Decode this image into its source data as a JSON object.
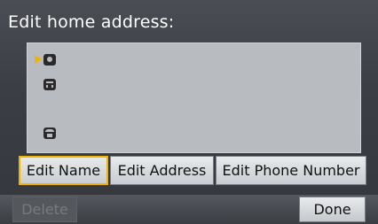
{
  "screen": {
    "title": "Edit home address:"
  },
  "address_list": {
    "entries": [
      {
        "icon": "person-icon",
        "selected": true
      },
      {
        "icon": "home-icon",
        "selected": false
      },
      {
        "icon": "phone-icon",
        "selected": false
      }
    ]
  },
  "tabs": [
    {
      "label": "Edit Name",
      "selected": true
    },
    {
      "label": "Edit Address",
      "selected": false
    },
    {
      "label": "Edit Phone Number",
      "selected": false
    }
  ],
  "footer": {
    "delete_label": "Delete",
    "delete_enabled": false,
    "done_label": "Done"
  },
  "colors": {
    "background": "#3e4147",
    "panel": "#b8bcc1",
    "highlight": "#f0b400",
    "button": "#e8eaec"
  }
}
